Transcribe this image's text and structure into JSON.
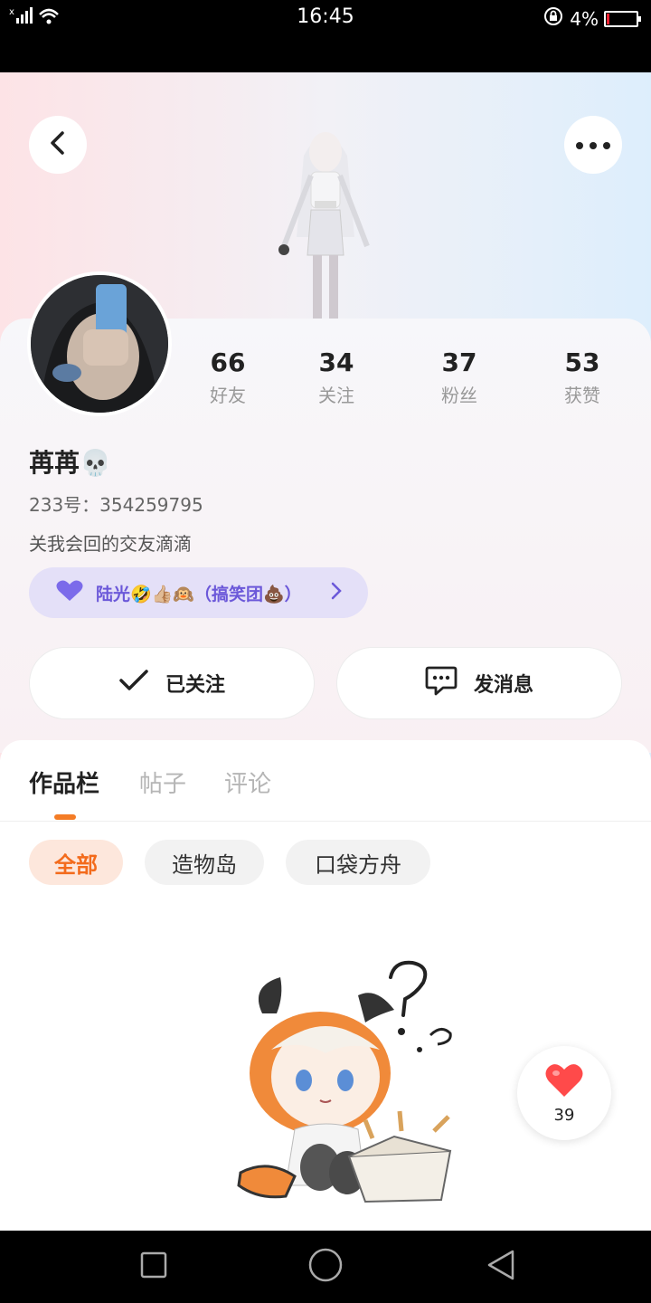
{
  "status_bar": {
    "signal": "× ▕▕▕",
    "time": "16:45",
    "battery_percent": "4%"
  },
  "header": {
    "back_icon": "chevron-left-icon",
    "more_icon": "more-dots-icon"
  },
  "profile": {
    "stats": [
      {
        "value": "66",
        "label": "好友"
      },
      {
        "value": "34",
        "label": "关注"
      },
      {
        "value": "37",
        "label": "粉丝"
      },
      {
        "value": "53",
        "label": "获赞"
      }
    ],
    "nickname": "苒苒💀",
    "uid_text": "233号：354259795",
    "bio": "关我会回的交友滴滴",
    "group_label": "陆光🤣👍🏼🙉（搞笑团💩）"
  },
  "actions": {
    "follow_label": "已关注",
    "message_label": "发消息"
  },
  "tabs": [
    {
      "label": "作品栏",
      "active": true
    },
    {
      "label": "帖子",
      "active": false
    },
    {
      "label": "评论",
      "active": false
    }
  ],
  "filters": [
    {
      "label": "全部",
      "active": true
    },
    {
      "label": "造物岛",
      "active": false
    },
    {
      "label": "口袋方舟",
      "active": false
    }
  ],
  "like_button": {
    "count": "39"
  },
  "colors": {
    "accent_orange": "#f47c26",
    "group_purple": "#6b58d9",
    "like_red": "#ff4a4a"
  }
}
